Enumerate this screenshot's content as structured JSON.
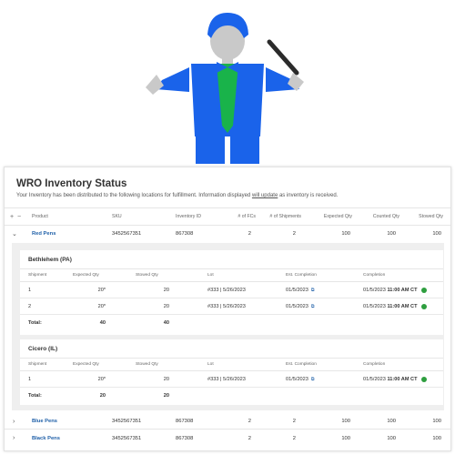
{
  "card": {
    "title": "WRO Inventory Status",
    "subtitle_pre": "Your Inventory has been distributed to the following locations for fulfillment.  Information displayed ",
    "subtitle_link": "will update",
    "subtitle_post": " as inventory is received."
  },
  "table": {
    "expand_all": "+",
    "collapse_all": "−",
    "columns": [
      "Product",
      "SKU",
      "Inventory ID",
      "# of FCs",
      "# of Shipments",
      "Expected Qty",
      "Counted Qty",
      "Stowed Qty"
    ],
    "rows": [
      {
        "chevron": "⌄",
        "product": "Red Pens",
        "sku": "3452567351",
        "inventory_id": "867308",
        "fcs": "2",
        "shipments": "2",
        "expected": "100",
        "counted": "100",
        "stowed": "100"
      },
      {
        "chevron": "›",
        "product": "Blue Pens",
        "sku": "3452567351",
        "inventory_id": "867308",
        "fcs": "2",
        "shipments": "2",
        "expected": "100",
        "counted": "100",
        "stowed": "100"
      },
      {
        "chevron": "›",
        "product": "Black Pens",
        "sku": "3452567351",
        "inventory_id": "867308",
        "fcs": "2",
        "shipments": "2",
        "expected": "100",
        "counted": "100",
        "stowed": "100"
      }
    ]
  },
  "locations": [
    {
      "name": "Bethlehem (PA)",
      "columns": [
        "Shipment",
        "Expected Qty",
        "Stowed Qty",
        "Lot",
        "Est. Completion",
        "Completion"
      ],
      "rows": [
        {
          "shipment": "1",
          "expected": "20*",
          "stowed": "20",
          "lot": "#333 | 5/26/2023",
          "est": "01/5/2023",
          "completion_date": "01/5/2023",
          "completion_time": "11:00 AM CT"
        },
        {
          "shipment": "2",
          "expected": "20*",
          "stowed": "20",
          "lot": "#333 | 5/26/2023",
          "est": "01/5/2023",
          "completion_date": "01/5/2023",
          "completion_time": "11:00 AM CT"
        }
      ],
      "total": {
        "label": "Total:",
        "expected": "40",
        "stowed": "40"
      }
    },
    {
      "name": "Cicero (IL)",
      "columns": [
        "Shipment",
        "Expected Qty",
        "Stowed Qty",
        "Lot",
        "Est. Completion",
        "Completion"
      ],
      "rows": [
        {
          "shipment": "1",
          "expected": "20*",
          "stowed": "20",
          "lot": "#333 | 5/26/2023",
          "est": "01/5/2023",
          "completion_date": "01/5/2023",
          "completion_time": "11:00 AM CT"
        }
      ],
      "total": {
        "label": "Total:",
        "expected": "20",
        "stowed": "20"
      }
    }
  ],
  "colors": {
    "link": "#1e5fa8",
    "status_ok": "#2e9e3f",
    "figure_blue": "#1a63ea",
    "figure_green": "#19b34a"
  }
}
